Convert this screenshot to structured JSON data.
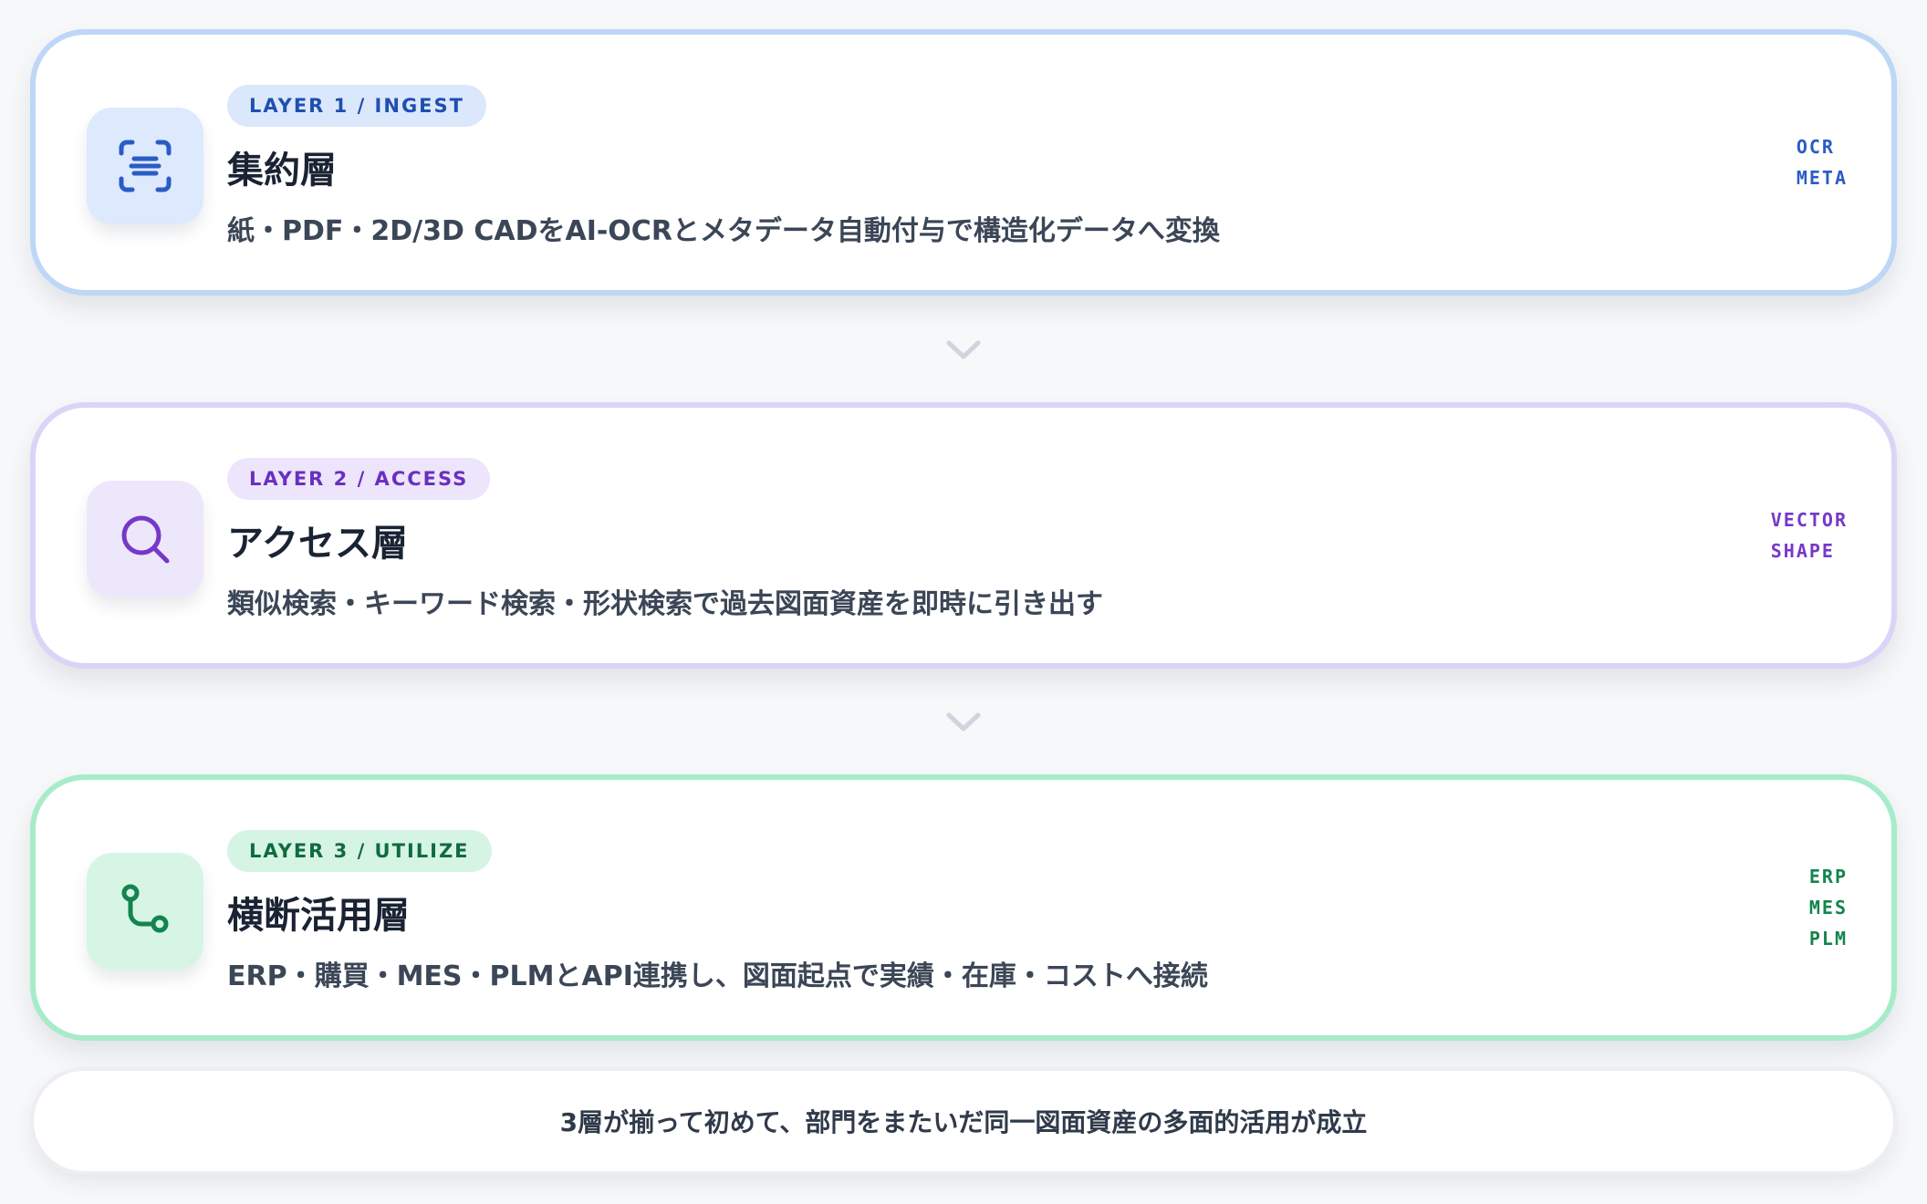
{
  "layers": [
    {
      "badge": "LAYER 1 / INGEST",
      "title": "集約層",
      "description": "紙・PDF・2D/3D CADをAI-OCRとメタデータ自動付与で構造化データへ変換",
      "tags": [
        "OCR",
        "META"
      ],
      "icon": "text-scan-icon",
      "accent": "#2a5cc4"
    },
    {
      "badge": "LAYER 2 / ACCESS",
      "title": "アクセス層",
      "description": "類似検索・キーワード検索・形状検索で過去図面資産を即時に引き出す",
      "tags": [
        "VECTOR",
        "SHAPE"
      ],
      "icon": "search-icon",
      "accent": "#7638c9"
    },
    {
      "badge": "LAYER 3 / UTILIZE",
      "title": "横断活用層",
      "description": "ERP・購買・MES・PLMとAPI連携し、図面起点で実績・在庫・コストへ接続",
      "tags": [
        "ERP",
        "MES",
        "PLM"
      ],
      "icon": "route-icon",
      "accent": "#13844d"
    }
  ],
  "footer": {
    "text": "3層が揃って初めて、部門をまたいだ同一図面資産の多面的活用が成立"
  }
}
